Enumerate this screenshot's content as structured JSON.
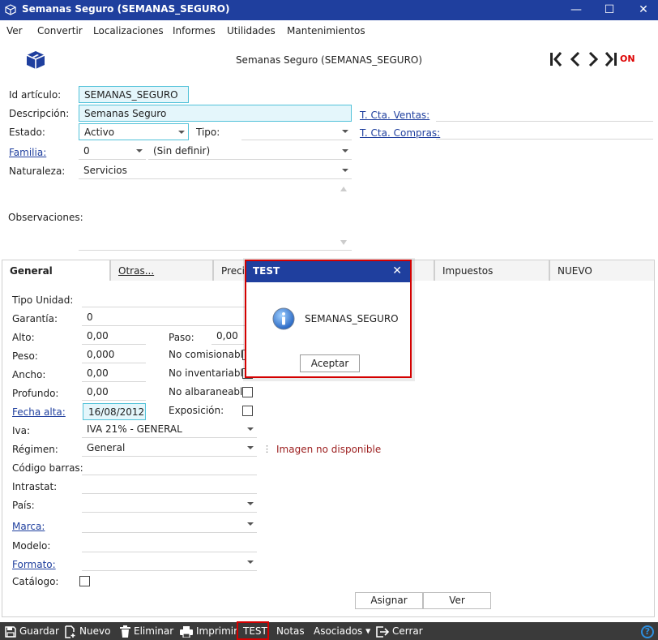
{
  "window": {
    "title": "Semanas Seguro (SEMANAS_SEGURO)",
    "minimize": "—",
    "maximize": "☐",
    "close": "✕"
  },
  "menu": [
    "Ver",
    "Convertir",
    "Localizaciones",
    "Informes",
    "Utilidades",
    "Mantenimientos"
  ],
  "header": {
    "title": "Semanas Seguro (SEMANAS_SEGURO)",
    "status": "ON"
  },
  "form": {
    "id_label": "Id artículo:",
    "id_value": "SEMANAS_SEGURO",
    "desc_label": "Descripción:",
    "desc_value": "Semanas Seguro",
    "estado_label": "Estado:",
    "estado_value": "Activo",
    "tipo_label": "Tipo:",
    "tipo_value": "",
    "familia_label": "Familia:",
    "familia_code": "0",
    "familia_value": "(Sin definir)",
    "naturaleza_label": "Naturaleza:",
    "naturaleza_value": "Servicios",
    "observaciones_label": "Observaciones:",
    "cta_ventas_label": "T. Cta. Ventas:",
    "cta_compras_label": "T. Cta. Compras:"
  },
  "tabs": [
    "General",
    "Otras...",
    "Preci",
    "Impuestos",
    "NUEVO"
  ],
  "general": {
    "tipo_unidad_label": "Tipo Unidad:",
    "garantia_label": "Garantía:",
    "garantia_value": "0",
    "alto_label": "Alto:",
    "alto_value": "0,00",
    "peso_label": "Peso:",
    "peso_value": "0,000",
    "ancho_label": "Ancho:",
    "ancho_value": "0,00",
    "profundo_label": "Profundo:",
    "profundo_value": "0,00",
    "fecha_alta_label": "Fecha alta:",
    "fecha_alta_value": "16/08/2012",
    "iva_label": "Iva:",
    "iva_value": "IVA 21% - GENERAL",
    "regimen_label": "Régimen:",
    "regimen_value": "General",
    "codigo_barras_label": "Código barras:",
    "intrastat_label": "Intrastat:",
    "pais_label": "País:",
    "marca_label": "Marca:",
    "modelo_label": "Modelo:",
    "formato_label": "Formato:",
    "catalogo_label": "Catálogo:",
    "paso_label": "Paso:",
    "paso_value": "0,00",
    "no_comisionable_label": "No comisionable",
    "no_inventariable_label": "No inventariable",
    "no_albaraneable_label": "No albaraneable:",
    "exposicion_label": "Exposición:",
    "imagen_label": "Imagen no disponible",
    "asignar_label": "Asignar",
    "ver_label": "Ver"
  },
  "toolbar": {
    "guardar": "Guardar",
    "nuevo": "Nuevo",
    "eliminar": "Eliminar",
    "imprimir": "Imprimir",
    "test": "TEST",
    "notas": "Notas",
    "asociados": "Asociados",
    "cerrar": "Cerrar",
    "help": "?"
  },
  "dialog": {
    "title": "TEST",
    "close": "✕",
    "message": "SEMANAS_SEGURO",
    "ok": "Aceptar"
  },
  "colors": {
    "titlebar": "#1f3f9e",
    "highlight_border": "#52c2d9",
    "highlight_fill": "#e4f6fb",
    "alert_red": "#d40000",
    "status_on": "#dd0000"
  }
}
